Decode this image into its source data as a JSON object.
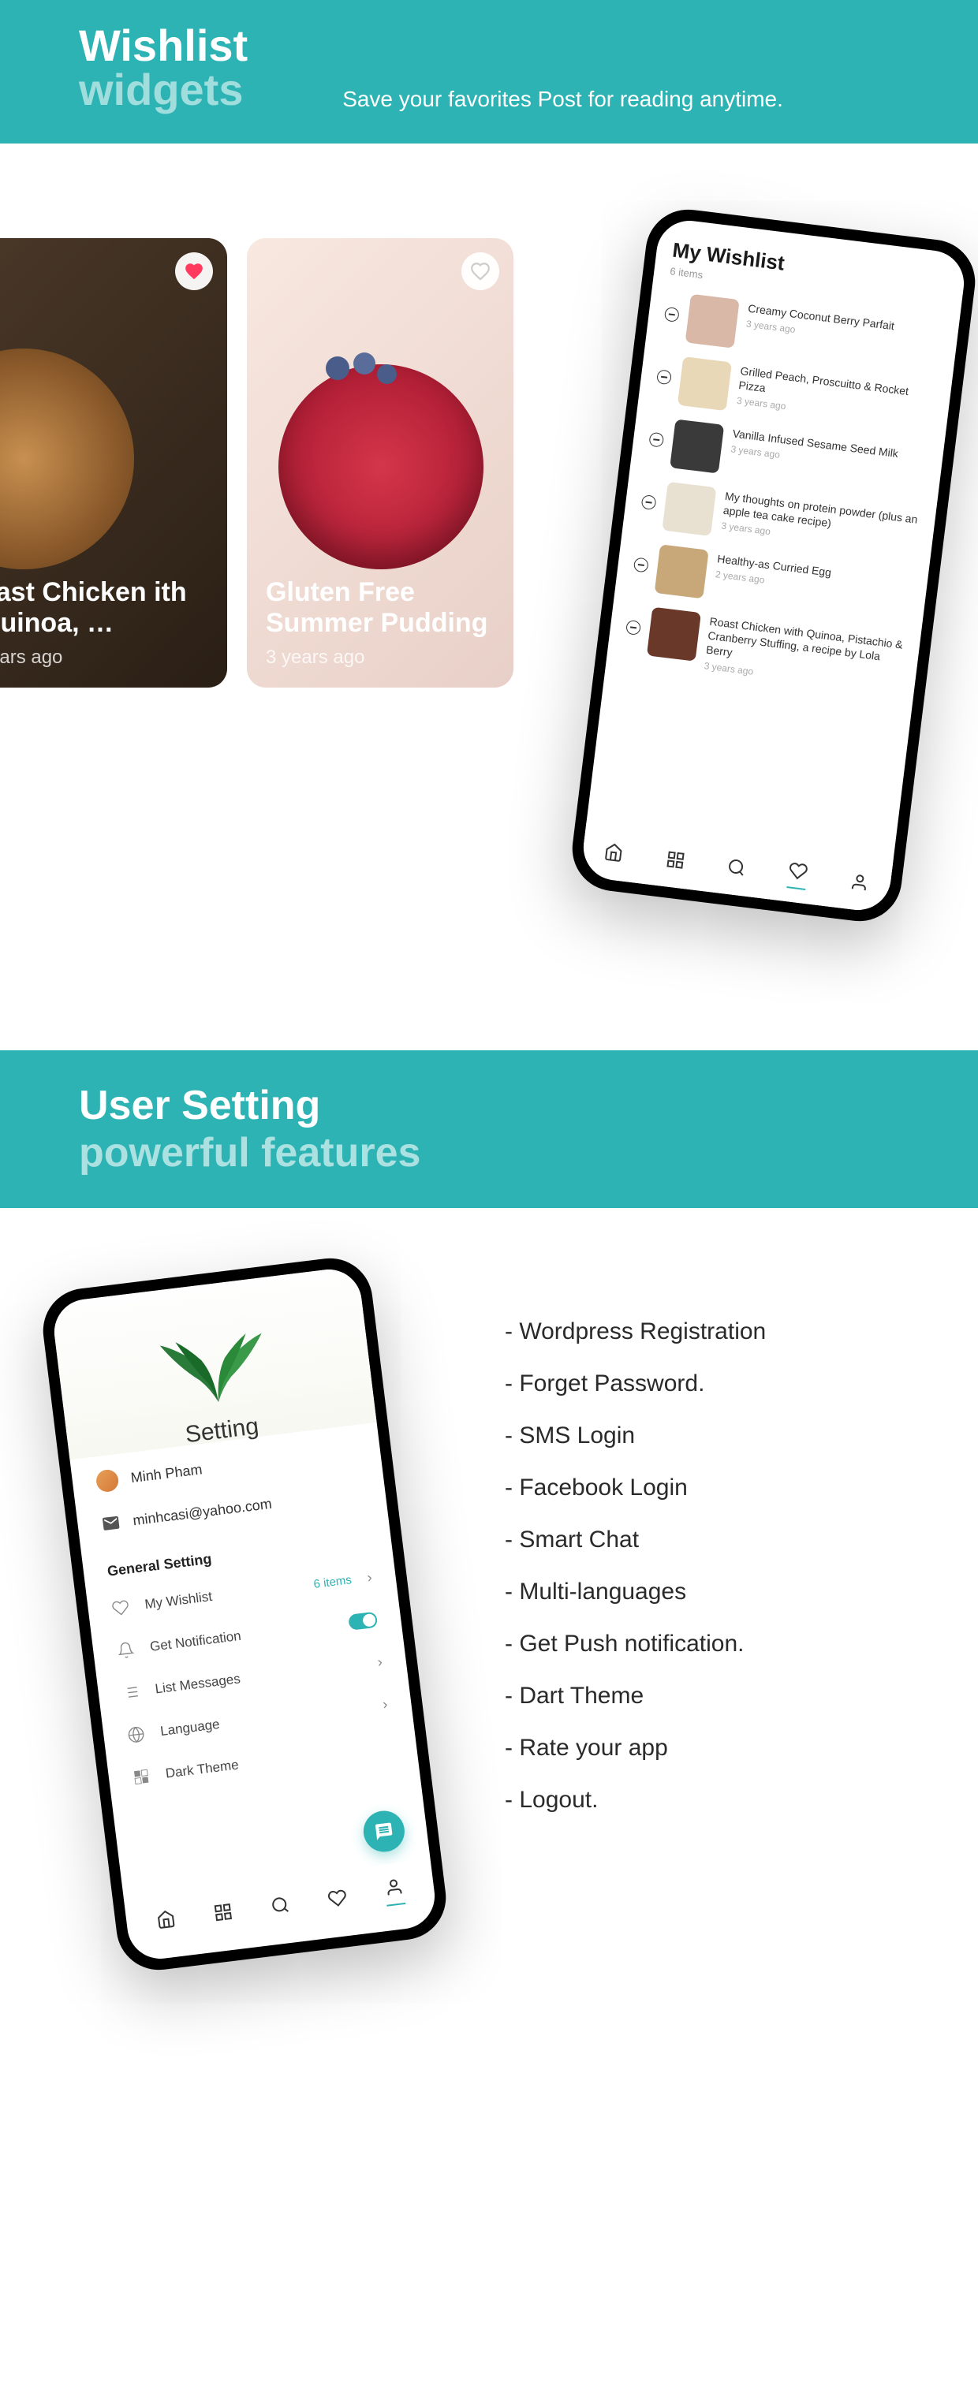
{
  "banner1": {
    "title": "Wishlist",
    "subtitle": "widgets",
    "description": "Save your favorites Post for reading anytime."
  },
  "cards": [
    {
      "title": "oast Chicken ith Quinoa, …",
      "time": "years ago",
      "heart_active": true
    },
    {
      "title": "Gluten Free Summer Pudding",
      "time": "3 years ago",
      "heart_active": false
    }
  ],
  "wishlist": {
    "title": "My Wishlist",
    "count": "6 items",
    "items": [
      {
        "name": "Creamy Coconut Berry Parfait",
        "time": "3 years ago",
        "thumb": "#d9b8a8"
      },
      {
        "name": "Grilled Peach, Proscuitto & Rocket Pizza",
        "time": "3 years ago",
        "thumb": "#e8d8b8"
      },
      {
        "name": "Vanilla Infused Sesame Seed Milk",
        "time": "3 years ago",
        "thumb": "#3a3a3a"
      },
      {
        "name": "My thoughts on protein powder (plus an apple tea cake recipe)",
        "time": "3 years ago",
        "thumb": "#e8e0d0"
      },
      {
        "name": "Healthy-as Curried Egg",
        "time": "2 years ago",
        "thumb": "#c8a878"
      },
      {
        "name": "Roast Chicken with Quinoa, Pistachio & Cranberry Stuffing, a recipe by Lola Berry",
        "time": "3 years ago",
        "thumb": "#6a3828"
      }
    ]
  },
  "banner2": {
    "title": "User Setting",
    "subtitle": "powerful features"
  },
  "settings": {
    "title": "Setting",
    "user_name": "Minh Pham",
    "user_email": "minhcasi@yahoo.com",
    "section_header": "General Setting",
    "rows": {
      "wishlist": {
        "label": "My Wishlist",
        "badge": "6 items"
      },
      "notification": {
        "label": "Get Notification"
      },
      "messages": {
        "label": "List Messages"
      },
      "language": {
        "label": "Language"
      },
      "dark": {
        "label": "Dark Theme"
      }
    }
  },
  "features": [
    "- Wordpress Registration",
    "- Forget Password.",
    "- SMS Login",
    "- Facebook Login",
    "- Smart Chat",
    "- Multi-languages",
    "- Get Push notification.",
    "- Dart Theme",
    "- Rate your app",
    "- Logout."
  ]
}
